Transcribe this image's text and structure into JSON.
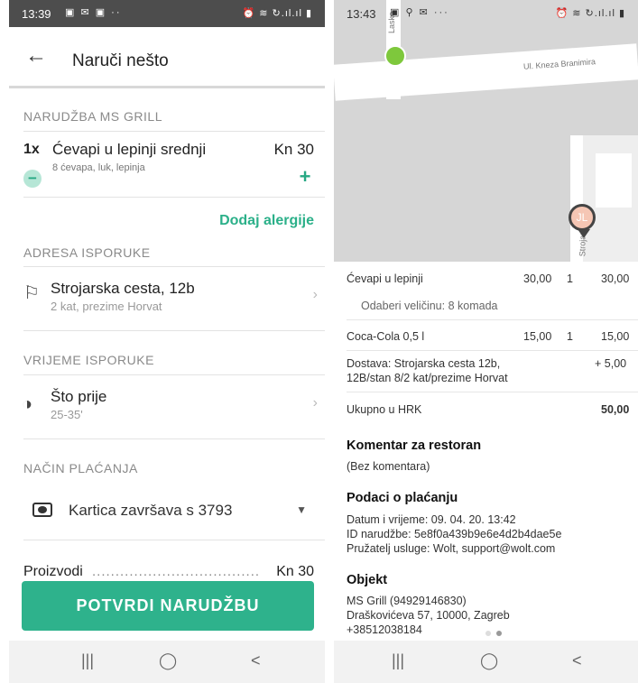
{
  "left": {
    "status": {
      "time": "13:39",
      "notif_icons": "▣ ✉ ▣ ··",
      "sys_icons": "⏰ ≋ ↻.ıl.ıl ▮"
    },
    "appbar": {
      "title": "Naruči nešto"
    },
    "order_section": "NARUDŽBA MS GRILL",
    "item": {
      "qty": "1x",
      "name": "Ćevapi u lepinji srednji",
      "price": "Kn 30",
      "desc": "8 ćevapa, luk, lepinja"
    },
    "allergy_link": "Dodaj alergije",
    "address_section": "ADRESA ISPORUKE",
    "address": {
      "main": "Strojarska cesta, 12b",
      "sub": "2 kat, prezime Horvat"
    },
    "time_section": "VRIJEME ISPORUKE",
    "time": {
      "main": "Što prije",
      "sub": "25-35'"
    },
    "payment_section": "NAČIN PLAĆANJA",
    "payment": {
      "card": "Kartica završava s 3793"
    },
    "total": {
      "label": "Proizvodi",
      "dots": "..............................................",
      "value": "Kn 30"
    },
    "confirm_button": "POTVRDI NARUDŽBU"
  },
  "right": {
    "status": {
      "time": "13:43",
      "notif_icons": "▣ ⚲ ✉ ···",
      "sys_icons": "⏰ ≋ ↻.ıl.ıl ▮"
    },
    "map": {
      "street_top": "Ul. Kneza Branimira",
      "street_vert": "Strojar",
      "street_left": "Lasko",
      "pin_label": "JL"
    },
    "receipt": {
      "rows": [
        {
          "name": "Ćevapi u lepinji",
          "price": "30,00",
          "qty": "1",
          "total": "30,00"
        },
        {
          "name": "Coca-Cola 0,5 l",
          "price": "15,00",
          "qty": "1",
          "total": "15,00"
        }
      ],
      "option": "Odaberi veličinu: 8 komada",
      "delivery_line1": "Dostava: Strojarska cesta 12b,",
      "delivery_line2": "12B/stan 8/2 kat/prezime Horvat",
      "delivery_total": "+ 5,00",
      "sum_label": "Ukupno u HRK",
      "sum_value": "50,00"
    },
    "comment": {
      "title": "Komentar za restoran",
      "text": "(Bez komentara)"
    },
    "payment_info": {
      "title": "Podaci o plaćanju",
      "lines": [
        "Datum i vrijeme: 09. 04. 20. 13:42",
        "ID narudžbe: 5e8f0a439b9e6e4d2b4dae5e",
        "Pružatelj usluge: Wolt, support@wolt.com"
      ]
    },
    "object": {
      "title": "Objekt",
      "lines": [
        "MS Grill (94929146830)",
        "Draškovićeva 57, 10000, Zagreb",
        "+38512038184"
      ]
    }
  },
  "nav": {
    "recents": "|||",
    "home": "◯",
    "back": "<"
  },
  "colors": {
    "accent": "#2eb28c",
    "map_bg": "#d6d6d6",
    "statusbar": "#4d4d4d"
  },
  "icons": [
    "back-arrow-icon",
    "minus-icon",
    "plus-icon",
    "flag-icon",
    "clock-icon",
    "chevron-right-icon",
    "card-icon",
    "caret-down-icon",
    "map-pin-icon"
  ]
}
